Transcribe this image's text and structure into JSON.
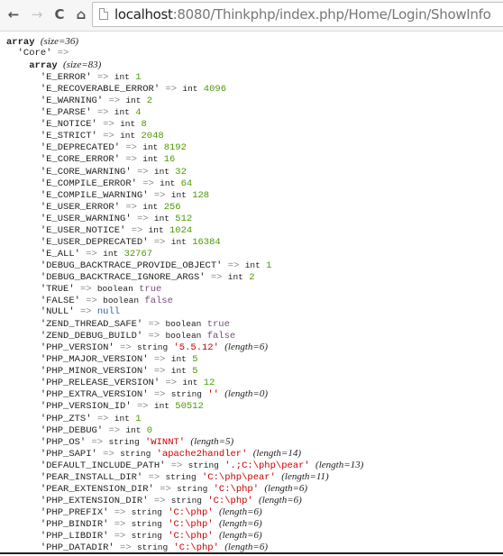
{
  "browser": {
    "back_label": "←",
    "forward_label": "→",
    "reload_label": "C",
    "home_label": "⌂",
    "url_host": "localhost",
    "url_rest": ":8080/Thinkphp/index.php/Home/Login/ShowInfo"
  },
  "dump": {
    "root_label": "array",
    "root_size": "(size=36)",
    "section_key": "'Core'",
    "arrow": "=>",
    "section_label": "array",
    "section_size": "(size=83)",
    "entries": [
      {
        "key": "'E_ERROR'",
        "type": "int",
        "value": "1",
        "kind": "int"
      },
      {
        "key": "'E_RECOVERABLE_ERROR'",
        "type": "int",
        "value": "4096",
        "kind": "int"
      },
      {
        "key": "'E_WARNING'",
        "type": "int",
        "value": "2",
        "kind": "int"
      },
      {
        "key": "'E_PARSE'",
        "type": "int",
        "value": "4",
        "kind": "int"
      },
      {
        "key": "'E_NOTICE'",
        "type": "int",
        "value": "8",
        "kind": "int"
      },
      {
        "key": "'E_STRICT'",
        "type": "int",
        "value": "2048",
        "kind": "int"
      },
      {
        "key": "'E_DEPRECATED'",
        "type": "int",
        "value": "8192",
        "kind": "int"
      },
      {
        "key": "'E_CORE_ERROR'",
        "type": "int",
        "value": "16",
        "kind": "int"
      },
      {
        "key": "'E_CORE_WARNING'",
        "type": "int",
        "value": "32",
        "kind": "int"
      },
      {
        "key": "'E_COMPILE_ERROR'",
        "type": "int",
        "value": "64",
        "kind": "int"
      },
      {
        "key": "'E_COMPILE_WARNING'",
        "type": "int",
        "value": "128",
        "kind": "int"
      },
      {
        "key": "'E_USER_ERROR'",
        "type": "int",
        "value": "256",
        "kind": "int"
      },
      {
        "key": "'E_USER_WARNING'",
        "type": "int",
        "value": "512",
        "kind": "int"
      },
      {
        "key": "'E_USER_NOTICE'",
        "type": "int",
        "value": "1024",
        "kind": "int"
      },
      {
        "key": "'E_USER_DEPRECATED'",
        "type": "int",
        "value": "16384",
        "kind": "int"
      },
      {
        "key": "'E_ALL'",
        "type": "int",
        "value": "32767",
        "kind": "int"
      },
      {
        "key": "'DEBUG_BACKTRACE_PROVIDE_OBJECT'",
        "type": "int",
        "value": "1",
        "kind": "int"
      },
      {
        "key": "'DEBUG_BACKTRACE_IGNORE_ARGS'",
        "type": "int",
        "value": "2",
        "kind": "int"
      },
      {
        "key": "'TRUE'",
        "type": "boolean",
        "value": "true",
        "kind": "bool"
      },
      {
        "key": "'FALSE'",
        "type": "boolean",
        "value": "false",
        "kind": "bool"
      },
      {
        "key": "'NULL'",
        "type": "",
        "value": "null",
        "kind": "null"
      },
      {
        "key": "'ZEND_THREAD_SAFE'",
        "type": "boolean",
        "value": "true",
        "kind": "bool"
      },
      {
        "key": "'ZEND_DEBUG_BUILD'",
        "type": "boolean",
        "value": "false",
        "kind": "bool"
      },
      {
        "key": "'PHP_VERSION'",
        "type": "string",
        "value": "'5.5.12'",
        "kind": "str",
        "length": "(length=6)"
      },
      {
        "key": "'PHP_MAJOR_VERSION'",
        "type": "int",
        "value": "5",
        "kind": "int"
      },
      {
        "key": "'PHP_MINOR_VERSION'",
        "type": "int",
        "value": "5",
        "kind": "int"
      },
      {
        "key": "'PHP_RELEASE_VERSION'",
        "type": "int",
        "value": "12",
        "kind": "int"
      },
      {
        "key": "'PHP_EXTRA_VERSION'",
        "type": "string",
        "value": "''",
        "kind": "str",
        "length": "(length=0)"
      },
      {
        "key": "'PHP_VERSION_ID'",
        "type": "int",
        "value": "50512",
        "kind": "int"
      },
      {
        "key": "'PHP_ZTS'",
        "type": "int",
        "value": "1",
        "kind": "int"
      },
      {
        "key": "'PHP_DEBUG'",
        "type": "int",
        "value": "0",
        "kind": "int"
      },
      {
        "key": "'PHP_OS'",
        "type": "string",
        "value": "'WINNT'",
        "kind": "str",
        "length": "(length=5)"
      },
      {
        "key": "'PHP_SAPI'",
        "type": "string",
        "value": "'apache2handler'",
        "kind": "str",
        "length": "(length=14)"
      },
      {
        "key": "'DEFAULT_INCLUDE_PATH'",
        "type": "string",
        "value": "'.;C:\\php\\pear'",
        "kind": "str",
        "length": "(length=13)"
      },
      {
        "key": "'PEAR_INSTALL_DIR'",
        "type": "string",
        "value": "'C:\\php\\pear'",
        "kind": "str",
        "length": "(length=11)"
      },
      {
        "key": "'PEAR_EXTENSION_DIR'",
        "type": "string",
        "value": "'C:\\php'",
        "kind": "str",
        "length": "(length=6)"
      },
      {
        "key": "'PHP_EXTENSION_DIR'",
        "type": "string",
        "value": "'C:\\php'",
        "kind": "str",
        "length": "(length=6)"
      },
      {
        "key": "'PHP_PREFIX'",
        "type": "string",
        "value": "'C:\\php'",
        "kind": "str",
        "length": "(length=6)"
      },
      {
        "key": "'PHP_BINDIR'",
        "type": "string",
        "value": "'C:\\php'",
        "kind": "str",
        "length": "(length=6)"
      },
      {
        "key": "'PHP_LIBDIR'",
        "type": "string",
        "value": "'C:\\php'",
        "kind": "str",
        "length": "(length=6)"
      },
      {
        "key": "'PHP_DATADIR'",
        "type": "string",
        "value": "'C:\\php'",
        "kind": "str",
        "length": "(length=6)"
      }
    ]
  },
  "colors": {
    "int": "#4e9a06",
    "bool": "#75507b",
    "null": "#3465a4",
    "str": "#cc0000",
    "arrow": "#888a85"
  }
}
